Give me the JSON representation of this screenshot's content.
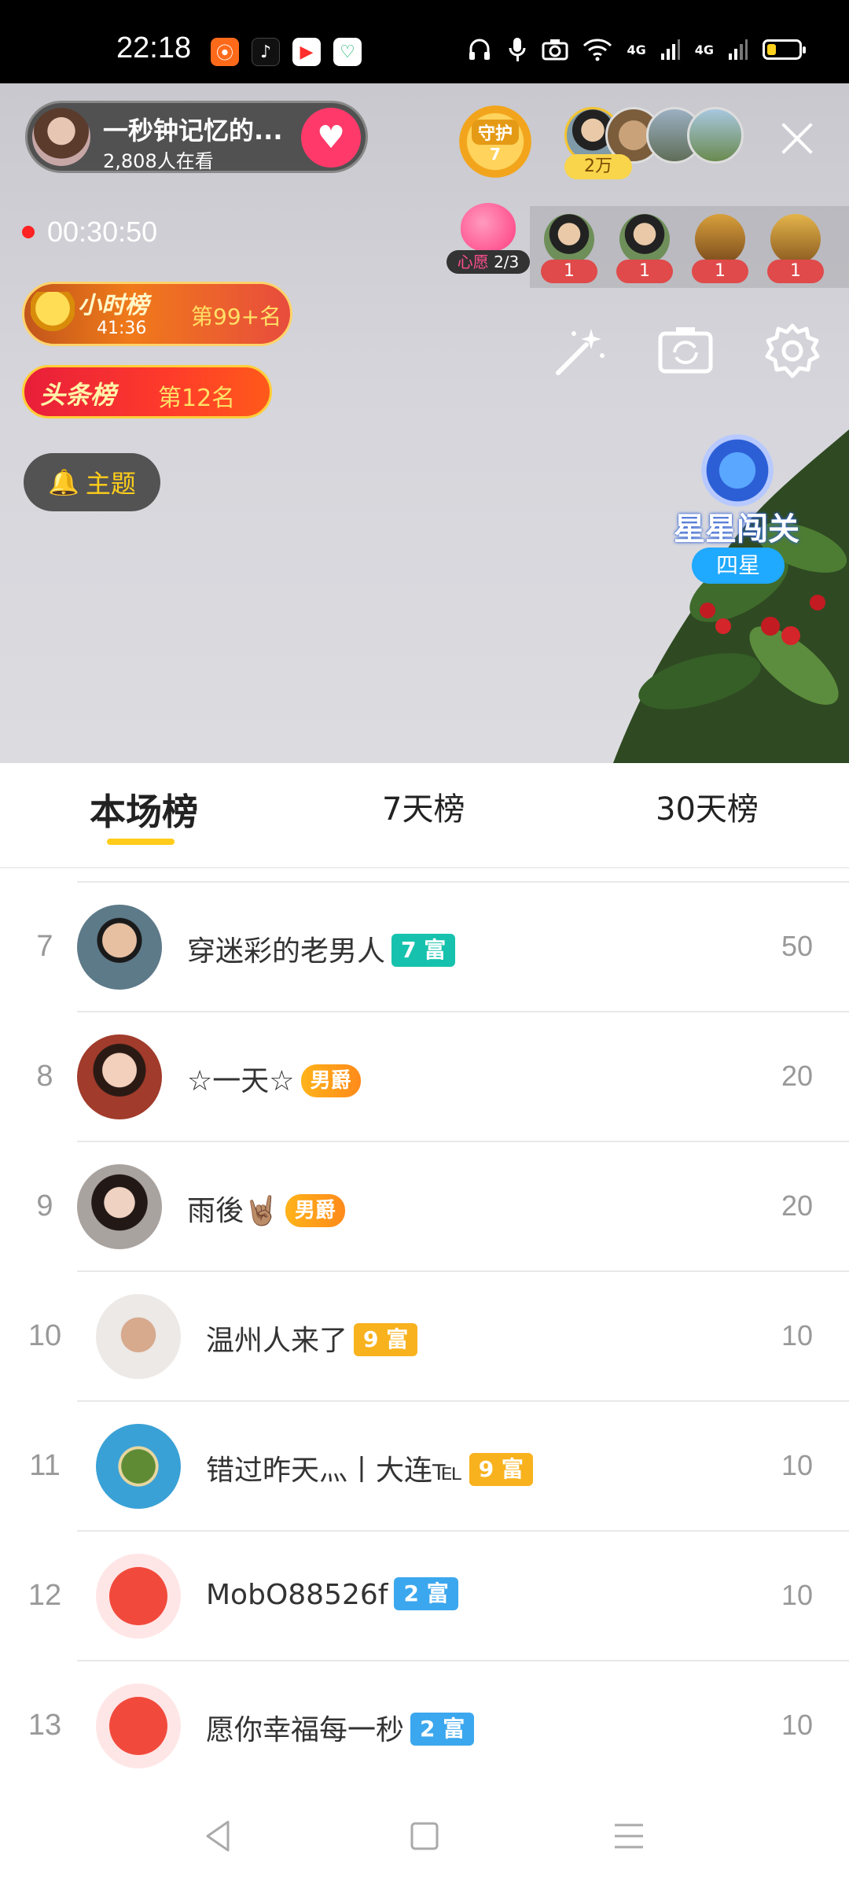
{
  "status_bar": {
    "time": "22:18",
    "network_1": "4G",
    "network_2": "4G",
    "battery_level": 0.3
  },
  "live": {
    "host_name": "一秒钟记忆的...",
    "viewers": "2,808人在看",
    "guard_label": "守护",
    "guard_count": "7",
    "top_viewer_count": "2万",
    "recording_time": "00:30:50",
    "wish_label": "心愿",
    "wish_progress": "2/3",
    "gift_counts": [
      "1",
      "1",
      "1",
      "1"
    ],
    "hour_rank_title": "小时榜",
    "hour_rank_time": "41:36",
    "hour_rank_position": "第99+名",
    "headline_rank_title": "头条榜",
    "headline_rank_position": "第12名",
    "theme_label": "主题",
    "star_title": "星星闯关",
    "star_level": "四星"
  },
  "tabs": [
    {
      "label": "本场榜",
      "active": true
    },
    {
      "label": "7天榜",
      "active": false
    },
    {
      "label": "30天榜",
      "active": false
    }
  ],
  "ranking": [
    {
      "rank": "7",
      "name": "穿迷彩的老男人",
      "badge": "7 富",
      "badge_type": "teal",
      "score": "50"
    },
    {
      "rank": "8",
      "name": "☆一天☆",
      "badge": "男爵",
      "badge_type": "noble",
      "score": "20"
    },
    {
      "rank": "9",
      "name": "雨後🤘🏽",
      "badge": "男爵",
      "badge_type": "noble",
      "score": "20"
    },
    {
      "rank": "10",
      "name": "温州人来了",
      "badge": "9 富",
      "badge_type": "gold",
      "score": "10"
    },
    {
      "rank": "11",
      "name": "错过昨天灬丨大连℡",
      "badge": "9 富",
      "badge_type": "gold",
      "score": "10"
    },
    {
      "rank": "12",
      "name": "MobO88526f",
      "badge": "2 富",
      "badge_type": "blue",
      "score": "10"
    },
    {
      "rank": "13",
      "name": "愿你幸福每一秒",
      "badge": "2 富",
      "badge_type": "blue",
      "score": "10"
    }
  ],
  "colors": {
    "accent": "#ffcc1a",
    "follow": "#ff3a6a",
    "badge_teal": "#16c2ad",
    "badge_gold": "#f8b21e",
    "badge_blue": "#3ba7ee"
  }
}
